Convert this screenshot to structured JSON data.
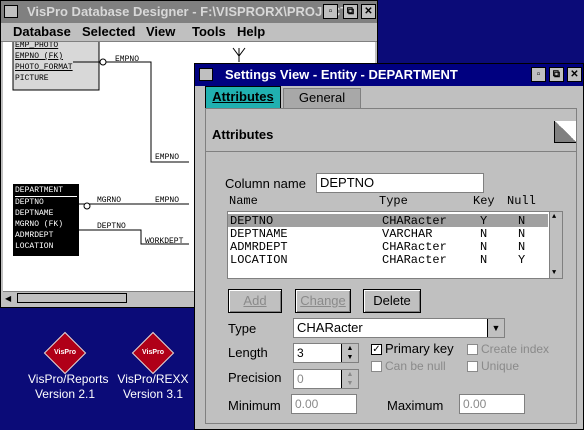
{
  "desktop": {
    "icons": [
      {
        "label": "VisPro/Reports",
        "version": "Version 2.1",
        "badge": "VisPro"
      },
      {
        "label": "VisPro/REXX",
        "version": "Version 3.1",
        "badge": "VisPro"
      }
    ]
  },
  "designer": {
    "title": "VisPro Database Designer - F:\\VISPRORX\\PROJECT",
    "menu": [
      "Database",
      "Selected",
      "View",
      "Tools",
      "Help"
    ],
    "entity_top": [
      "EMP_PHOTO",
      "EMPNO (FK)",
      "PHOTO_FORMAT",
      "PICTURE"
    ],
    "entity_dept": [
      "DEPARTMENT",
      "DEPTNO",
      "DEPTNAME",
      "MGRNO (FK)",
      "ADMRDEPT",
      "LOCATION"
    ],
    "rel_labels": [
      "EMPNO",
      "EMPNO",
      "MGRNO",
      "EMPNO",
      "DEPTNO",
      "WORKDEPT"
    ]
  },
  "settings": {
    "title": "Settings View - Entity - DEPARTMENT",
    "tabs": [
      "Attributes",
      "General"
    ],
    "heading": "Attributes",
    "column_name_label": "Column name",
    "column_name_value": "DEPTNO",
    "columns": [
      "Name",
      "Type",
      "Key",
      "Null"
    ],
    "rows": [
      {
        "name": "DEPTNO",
        "type": "CHARacter",
        "key": "Y",
        "null": "N"
      },
      {
        "name": "DEPTNAME",
        "type": "VARCHAR",
        "key": "N",
        "null": "N"
      },
      {
        "name": "ADMRDEPT",
        "type": "CHARacter",
        "key": "N",
        "null": "N"
      },
      {
        "name": "LOCATION",
        "type": "CHARacter",
        "key": "N",
        "null": "Y"
      }
    ],
    "buttons": {
      "add": "Add",
      "change": "Change",
      "delete": "Delete"
    },
    "type_label": "Type",
    "type_value": "CHARacter",
    "length_label": "Length",
    "length_value": "3",
    "precision_label": "Precision",
    "precision_value": "0",
    "primary_key": "Primary key",
    "create_index": "Create index",
    "can_be_null": "Can be null",
    "unique": "Unique",
    "minimum_label": "Minimum",
    "minimum_value": "0.00",
    "maximum_label": "Maximum",
    "maximum_value": "0.00"
  }
}
